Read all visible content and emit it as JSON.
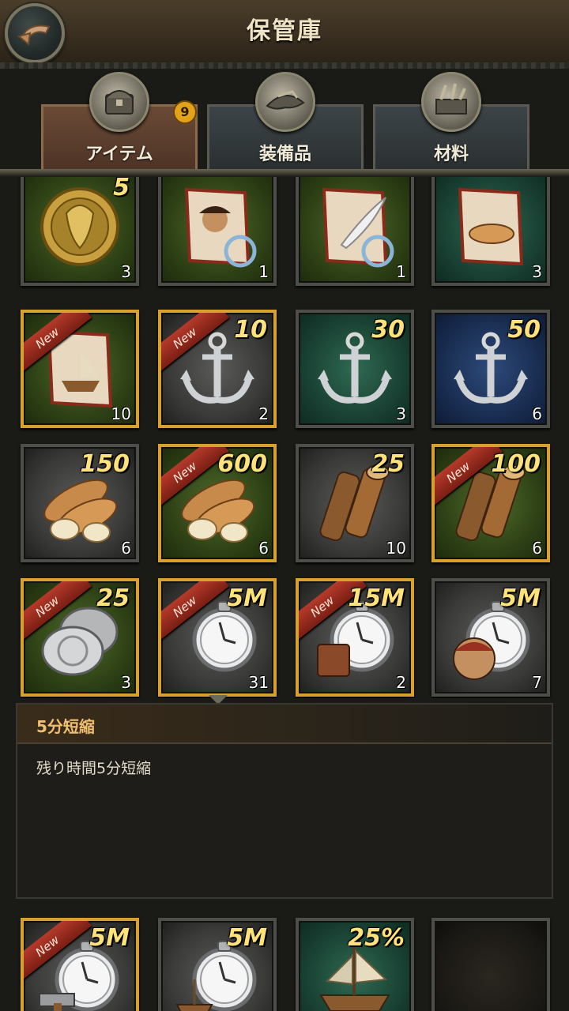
{
  "header": {
    "title": "保管庫"
  },
  "tabs": [
    {
      "label": "アイテム",
      "badge": "9",
      "active": true,
      "icon": "chest-icon"
    },
    {
      "label": "装備品",
      "badge": "",
      "active": false,
      "icon": "hat-icon"
    },
    {
      "label": "材料",
      "badge": "",
      "active": false,
      "icon": "materials-icon"
    }
  ],
  "grid": {
    "rows": [
      [
        {
          "value": "5",
          "count": "3",
          "new": false,
          "art": "mermaid-medallion-icon",
          "bg": "green"
        },
        {
          "value": "",
          "count": "1",
          "new": false,
          "art": "pirate-scroll-icon",
          "bg": "green"
        },
        {
          "value": "",
          "count": "1",
          "new": false,
          "art": "quill-scroll-icon",
          "bg": "green"
        },
        {
          "value": "",
          "count": "3",
          "new": false,
          "art": "bread-scroll-icon",
          "bg": "teal"
        }
      ],
      [
        {
          "value": "",
          "count": "10",
          "new": true,
          "ribbon": "New",
          "art": "ship-scroll-icon",
          "bg": "green"
        },
        {
          "value": "10",
          "count": "2",
          "new": true,
          "ribbon": "New",
          "art": "anchor-icon",
          "bg": "grey"
        },
        {
          "value": "30",
          "count": "3",
          "new": false,
          "art": "anchor-icon",
          "bg": "teal"
        },
        {
          "value": "50",
          "count": "6",
          "new": false,
          "art": "anchor-icon",
          "bg": "blue"
        }
      ],
      [
        {
          "value": "150",
          "count": "6",
          "new": false,
          "art": "bread-icon",
          "bg": "grey"
        },
        {
          "value": "600",
          "count": "6",
          "new": true,
          "ribbon": "New",
          "art": "bread-icon",
          "bg": "green"
        },
        {
          "value": "25",
          "count": "10",
          "new": false,
          "art": "wood-icon",
          "bg": "grey"
        },
        {
          "value": "100",
          "count": "6",
          "new": true,
          "ribbon": "New",
          "art": "wood-icon",
          "bg": "green"
        }
      ],
      [
        {
          "value": "25",
          "count": "3",
          "new": true,
          "ribbon": "New",
          "art": "silver-coin-icon",
          "bg": "green"
        },
        {
          "value": "5M",
          "count": "31",
          "new": true,
          "ribbon": "New",
          "art": "stopwatch-icon",
          "bg": "grey"
        },
        {
          "value": "15M",
          "count": "2",
          "new": true,
          "ribbon": "New",
          "art": "stopwatch-book-icon",
          "bg": "grey"
        },
        {
          "value": "5M",
          "count": "7",
          "new": false,
          "art": "stopwatch-pirate-icon",
          "bg": "grey"
        }
      ]
    ],
    "bottom_row": [
      {
        "value": "5M",
        "count": "",
        "new": true,
        "ribbon": "New",
        "art": "stopwatch-hammer-icon",
        "bg": "grey"
      },
      {
        "value": "5M",
        "count": "",
        "new": false,
        "art": "stopwatch-ship-icon",
        "bg": "grey"
      },
      {
        "value": "25%",
        "count": "",
        "new": false,
        "art": "ship-icon",
        "bg": "teal"
      },
      {
        "value": "",
        "count": "",
        "new": false,
        "art": "",
        "bg": "dark"
      }
    ]
  },
  "description": {
    "title": "5分短縮",
    "body": "残り時間5分短縮"
  }
}
